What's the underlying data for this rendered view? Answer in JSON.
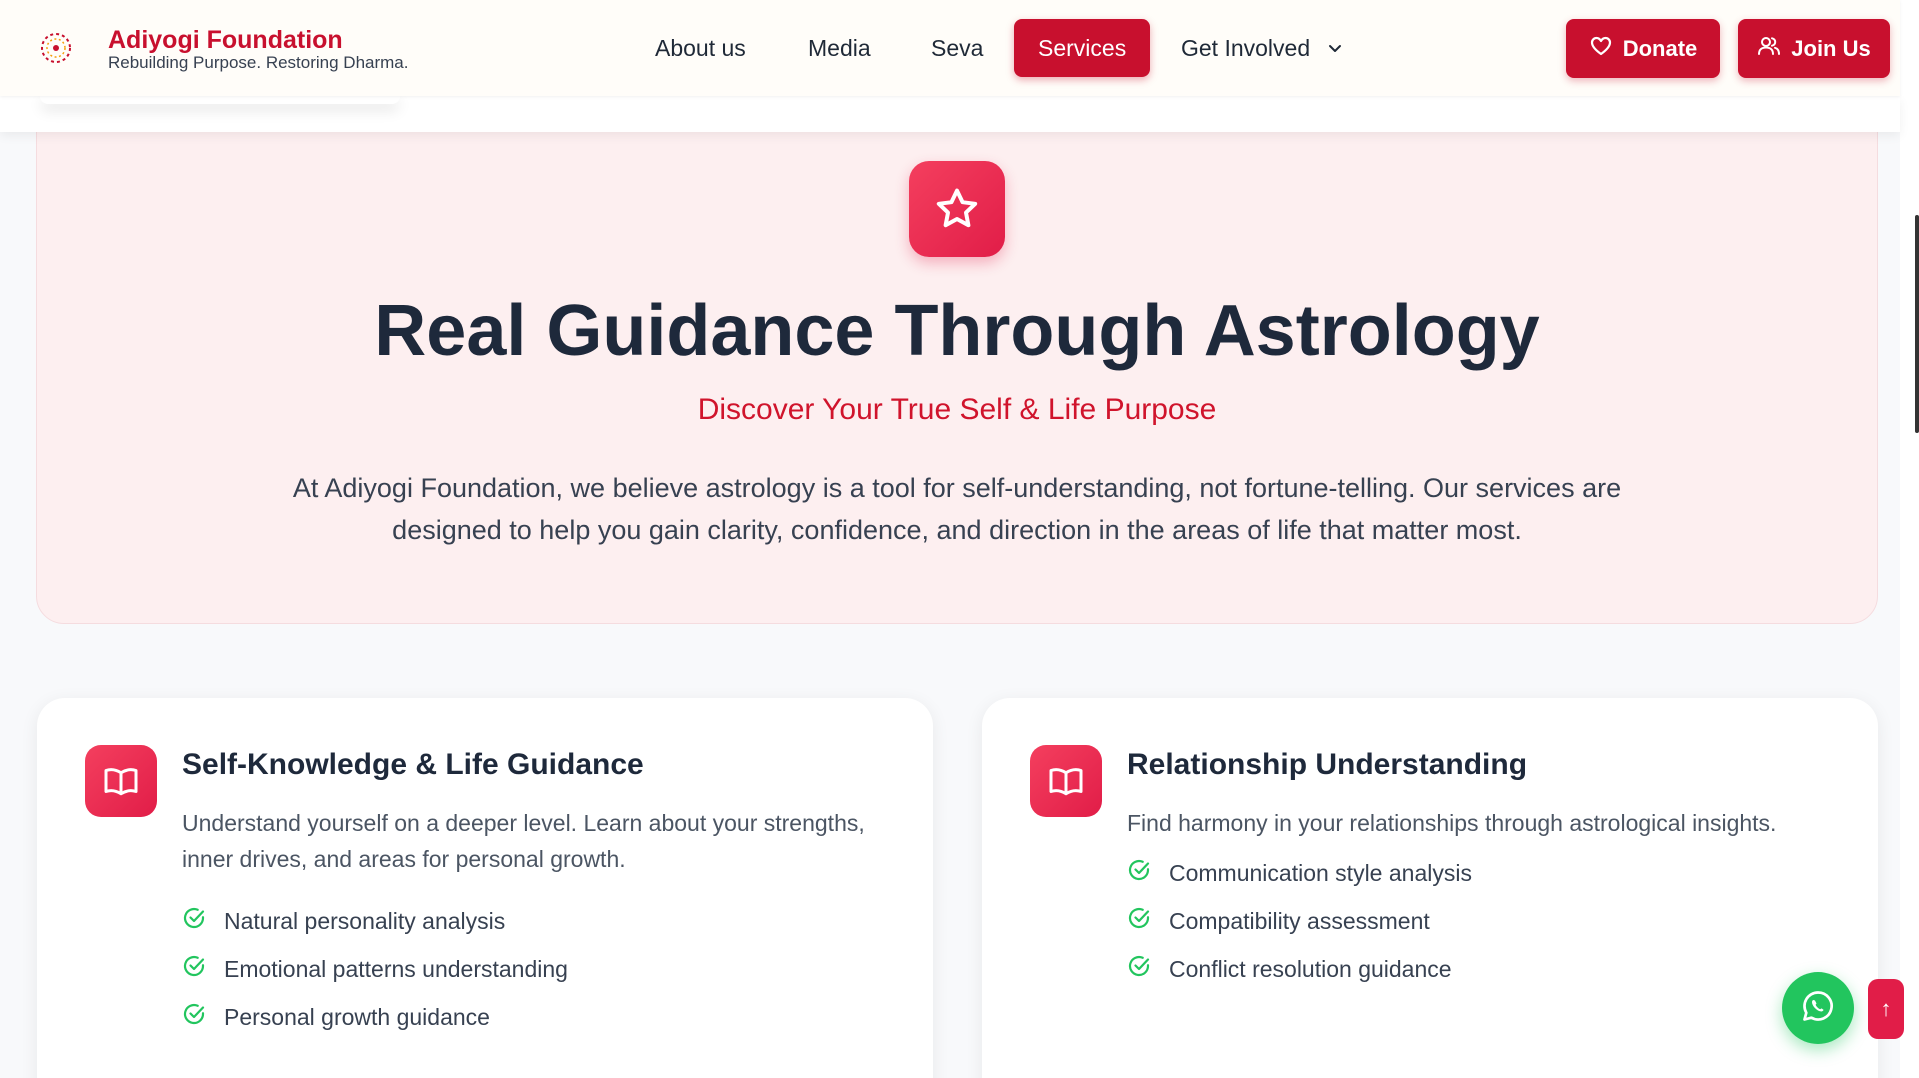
{
  "brand": {
    "name": "Adiyogi Foundation",
    "tagline": "Rebuilding Purpose. Restoring Dharma.",
    "logo_icon": "mandala-icon"
  },
  "nav": {
    "items": [
      {
        "label": "About us"
      },
      {
        "label": "Media"
      },
      {
        "label": "Seva"
      },
      {
        "label": "Services",
        "active": true
      },
      {
        "label": "Get Involved",
        "has_dropdown": true
      }
    ]
  },
  "header_buttons": {
    "donate": {
      "label": "Donate",
      "icon": "heart-icon"
    },
    "join": {
      "label": "Join Us",
      "icon": "users-icon"
    }
  },
  "hero": {
    "icon": "star-icon",
    "title": "Real Guidance Through Astrology",
    "subtitle": "Discover Your True Self & Life Purpose",
    "description": "At Adiyogi Foundation, we believe astrology is a tool for self-understanding, not fortune-telling. Our services are designed to help you gain clarity, confidence, and direction in the areas of life that matter most."
  },
  "cards": [
    {
      "icon": "book-open-icon",
      "title": "Self-Knowledge & Life Guidance",
      "description": "Understand yourself on a deeper level. Learn about your strengths, inner drives, and areas for personal growth.",
      "features": [
        "Natural personality analysis",
        "Emotional patterns understanding",
        "Personal growth guidance"
      ]
    },
    {
      "icon": "book-open-icon",
      "title": "Relationship Understanding",
      "description": "Find harmony in your relationships through astrological insights.",
      "features": [
        "Communication style analysis",
        "Compatibility assessment",
        "Conflict resolution guidance"
      ]
    }
  ],
  "floating": {
    "whatsapp_icon": "whatsapp-icon",
    "back_to_top": "↑"
  },
  "colors": {
    "brand_red": "#c8102e",
    "accent_rose": "#e11d48",
    "check_green": "#22c55e",
    "hero_bg": "#fdeff0"
  }
}
